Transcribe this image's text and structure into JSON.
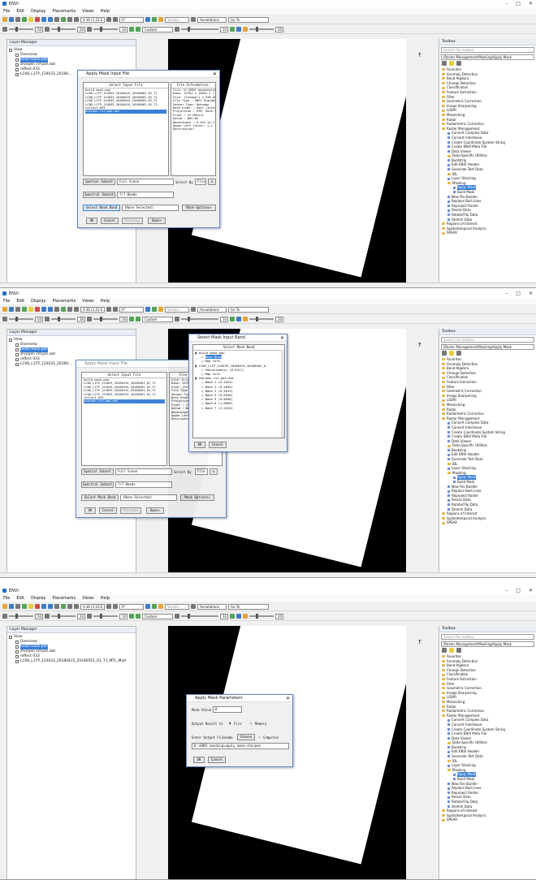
{
  "app": {
    "title": "ENVI",
    "menu": [
      "File",
      "Edit",
      "Display",
      "Placemarks",
      "Views",
      "Help"
    ],
    "toolbar": {
      "zoom": "4.36 (1:23 E",
      "rotation": "0°",
      "vectors": "Vectors",
      "annotations": "Annotations",
      "goto": "Go To",
      "stretch": "Custom",
      "value_50": "50",
      "value_10": "10",
      "value_20": "20",
      "value_0": "0"
    }
  },
  "layer_manager": {
    "title": "Layer Manager",
    "items_1": [
      {
        "label": "View",
        "indent": 0,
        "selected": false
      },
      {
        "label": "Overview",
        "indent": 1,
        "selected": false
      },
      {
        "label": "build mask-pan",
        "indent": 1,
        "selected": true
      },
      {
        "label": "sharpen rsf-pan.dat",
        "indent": 1,
        "selected": false
      },
      {
        "label": "reflect 033",
        "indent": 1,
        "selected": false
      },
      {
        "label": "LC08_L1TP_124033_20180...",
        "indent": 1,
        "selected": false
      }
    ],
    "items_2": [
      {
        "label": "View",
        "indent": 0,
        "selected": false
      },
      {
        "label": "Overview",
        "indent": 1,
        "selected": false
      },
      {
        "label": "build mask-pan",
        "indent": 1,
        "selected": true
      },
      {
        "label": "sharpen rsf-pan.dat",
        "indent": 1,
        "selected": false
      },
      {
        "label": "reflect 033",
        "indent": 1,
        "selected": false
      },
      {
        "label": "LC08_L1TP_124033_20180...",
        "indent": 1,
        "selected": false
      }
    ],
    "items_3": [
      {
        "label": "View",
        "indent": 0,
        "selected": false
      },
      {
        "label": "Overview",
        "indent": 1,
        "selected": false
      },
      {
        "label": "build mask-pan",
        "indent": 1,
        "selected": true
      },
      {
        "label": "sharpen rsf-pan.dat",
        "indent": 1,
        "selected": false
      },
      {
        "label": "reflect 033",
        "indent": 1,
        "selected": false
      },
      {
        "label": "LC08_L1TP_124033_20180415_20180501_01_T1_MTL_Mult",
        "indent": 1,
        "selected": false
      }
    ]
  },
  "toolbox": {
    "title": "Toolbox",
    "search_placeholder": "Search the toolbox",
    "path": "/Raster Management/Masking/Apply Mask",
    "items": [
      {
        "label": "Favorites",
        "indent": 0,
        "kind": "folder",
        "selected": false
      },
      {
        "label": "Anomaly Detection",
        "indent": 0,
        "kind": "folder",
        "selected": false
      },
      {
        "label": "Band Algebra",
        "indent": 0,
        "kind": "folder",
        "selected": false
      },
      {
        "label": "Change Detection",
        "indent": 0,
        "kind": "folder",
        "selected": false
      },
      {
        "label": "Classification",
        "indent": 0,
        "kind": "folder",
        "selected": false
      },
      {
        "label": "Feature Extraction",
        "indent": 0,
        "kind": "folder",
        "selected": false
      },
      {
        "label": "Filter",
        "indent": 0,
        "kind": "folder",
        "selected": false
      },
      {
        "label": "Geometric Correction",
        "indent": 0,
        "kind": "folder",
        "selected": false
      },
      {
        "label": "Image Sharpening",
        "indent": 0,
        "kind": "folder",
        "selected": false
      },
      {
        "label": "LiDAR",
        "indent": 0,
        "kind": "folder",
        "selected": false
      },
      {
        "label": "Mosaicking",
        "indent": 0,
        "kind": "folder",
        "selected": false
      },
      {
        "label": "Radar",
        "indent": 0,
        "kind": "folder",
        "selected": false
      },
      {
        "label": "Radiometric Correction",
        "indent": 0,
        "kind": "folder",
        "selected": false
      },
      {
        "label": "Raster Management",
        "indent": 0,
        "kind": "folder",
        "selected": false
      },
      {
        "label": "Convert Complex Data",
        "indent": 1,
        "kind": "tool",
        "selected": false
      },
      {
        "label": "Convert Interleave",
        "indent": 1,
        "kind": "tool",
        "selected": false
      },
      {
        "label": "Create Coordinate System String",
        "indent": 1,
        "kind": "tool",
        "selected": false
      },
      {
        "label": "Create ENVI Meta File",
        "indent": 1,
        "kind": "tool",
        "selected": false
      },
      {
        "label": "Data Viewer",
        "indent": 1,
        "kind": "tool",
        "selected": false
      },
      {
        "label": "Data-Specific Utilities",
        "indent": 1,
        "kind": "folder",
        "selected": false
      },
      {
        "label": "Bootstrip",
        "indent": 1,
        "kind": "tool",
        "selected": false
      },
      {
        "label": "Edit ENVI Header",
        "indent": 1,
        "kind": "tool",
        "selected": false
      },
      {
        "label": "Generate Test Data",
        "indent": 1,
        "kind": "tool",
        "selected": false
      },
      {
        "label": "IDL",
        "indent": 1,
        "kind": "folder",
        "selected": false
      },
      {
        "label": "Layer Stacking",
        "indent": 1,
        "kind": "tool",
        "selected": false
      },
      {
        "label": "Masking",
        "indent": 1,
        "kind": "folder",
        "selected": false
      },
      {
        "label": "Apply Mask",
        "indent": 2,
        "kind": "tool",
        "selected": true
      },
      {
        "label": "Build Mask",
        "indent": 2,
        "kind": "tool",
        "selected": false
      },
      {
        "label": "New File Builder",
        "indent": 1,
        "kind": "tool",
        "selected": false
      },
      {
        "label": "Replace Bad Lines",
        "indent": 1,
        "kind": "tool",
        "selected": false
      },
      {
        "label": "Reproject Raster",
        "indent": 1,
        "kind": "tool",
        "selected": false
      },
      {
        "label": "Resize Data",
        "indent": 1,
        "kind": "tool",
        "selected": false
      },
      {
        "label": "Rotate/Flip Data",
        "indent": 1,
        "kind": "tool",
        "selected": false
      },
      {
        "label": "Stretch Data",
        "indent": 1,
        "kind": "tool",
        "selected": false
      },
      {
        "label": "Regions of Interest",
        "indent": 0,
        "kind": "folder",
        "selected": false
      },
      {
        "label": "Spatiotemporal Analysis",
        "indent": 0,
        "kind": "folder",
        "selected": false
      },
      {
        "label": "SPEAR",
        "indent": 0,
        "kind": "folder",
        "selected": false
      }
    ]
  },
  "apply_mask_input": {
    "title": "Apply Mask Input File",
    "select_header": "Select Input File",
    "files": [
      {
        "label": "build mask-pan",
        "selected": false
      },
      {
        "label": "LC08_L1TP_124033_20180415_20180501_01_T1",
        "selected": false
      },
      {
        "label": "LC08_L1TP_124033_20180415_20180501_01_T1",
        "selected": false
      },
      {
        "label": "LC08_L1TP_124033_20180415_20180501_01_T1",
        "selected": false
      },
      {
        "label": "LC08_L1TP_124033_20180415_20180501_01_T1",
        "selected": false
      },
      {
        "label": "reflect 033",
        "selected": false
      },
      {
        "label": "sharpen rsf-pan.dat",
        "selected": true
      }
    ],
    "info_header": "File Information:",
    "info_lines": [
      "File: D:\\ENVI banding\\sharpen rsf-pan.dat",
      "Dims: 15701 x 15841 x 7 [BSQ]",
      "Size: [Integer] 2,536,584,374 bytes",
      "File Type  : ENVI Standard",
      "Sensor Type: Unknown",
      "Byte Order : Host (Intel)",
      "Projection : UTM, Zone 50 North",
      "  Pixel    : 15 Meters",
      "  Datum    : WGS-84",
      "Wavelength : 0.443 to 2.201 Micrometers",
      "Upper Left Corner: 1,1",
      "Description:"
    ],
    "spatial_subset_label": "Spatial Subset",
    "spatial_subset_value": "Full Scene",
    "spectral_subset_label": "Spectral Subset",
    "spectral_subset_value": "7/7 Bands",
    "select_by": "Select By",
    "select_by_value": "File",
    "select_mask_band": "Select Mask Band",
    "mask_band_value": "(None Selected)",
    "mask_options": "Mask Options",
    "ok": "OK",
    "cancel": "Cancel",
    "previous": "Previous",
    "open": "Open"
  },
  "select_mask_band": {
    "title": "Select Mask Input Band",
    "header": "Select Mask Band",
    "tree": [
      {
        "label": "build mask-pan",
        "indent": 0,
        "selected": false
      },
      {
        "label": "Mask Band",
        "indent": 1,
        "selected": true
      },
      {
        "label": "Map Info",
        "indent": 1,
        "selected": false
      },
      {
        "label": "LC08_L1TP_124033_20180415_20180501_0",
        "indent": 0,
        "selected": false
      },
      {
        "label": "Panchromatic (0.5917)",
        "indent": 1,
        "selected": false
      },
      {
        "label": "Map Info",
        "indent": 1,
        "selected": false
      },
      {
        "label": "sharpen rsf-pan.dat",
        "indent": 0,
        "selected": false
      },
      {
        "label": "Band 1 (0.4433)",
        "indent": 1,
        "selected": false
      },
      {
        "label": "Band 2 (0.4826)",
        "indent": 1,
        "selected": false
      },
      {
        "label": "Band 3 (0.5613)",
        "indent": 1,
        "selected": false
      },
      {
        "label": "Band 4 (0.6546)",
        "indent": 1,
        "selected": false
      },
      {
        "label": "Band 5 (0.8646)",
        "indent": 1,
        "selected": false
      },
      {
        "label": "Band 6 (1.6090)",
        "indent": 1,
        "selected": false
      },
      {
        "label": "Band 7 (2.2010)",
        "indent": 1,
        "selected": false
      }
    ],
    "ok": "OK",
    "cancel": "Cancel"
  },
  "apply_mask_params": {
    "title": "Apply Mask Parameters",
    "mask_value_label": "Mask Value",
    "mask_value": "0",
    "output_result_to": "Output Result to",
    "opt_file": "File",
    "opt_memory": "Memory",
    "enter_output": "Enter Output Filename",
    "choose": "Choose",
    "compress": "Compress",
    "output_path": "D:\\ENVI banding\\apply mask-sharpen",
    "ok": "OK",
    "cancel": "Cancel"
  }
}
